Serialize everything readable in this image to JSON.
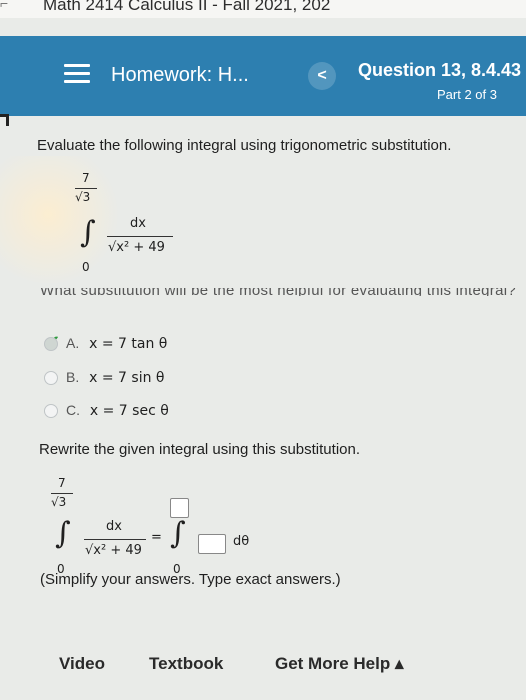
{
  "course": {
    "title": "Math 2414 Calculus II - Fall 2021, 202"
  },
  "header": {
    "homework_title": "Homework: H...",
    "back_glyph": "<",
    "question_title": "Question 13, 8.4.43",
    "part": "Part 2 of 3"
  },
  "question": {
    "prompt": "Evaluate the following integral using trigonometric substitution.",
    "integral": {
      "upper_num": "7",
      "upper_den": "√3",
      "lower": "0",
      "numerator": "dx",
      "denominator": "√x² + 49"
    },
    "cut_text": "What substitution will be the most helpful for evaluating this integral?",
    "choices": [
      {
        "letter": "A.",
        "expr": "x = 7 tan θ",
        "selected": true
      },
      {
        "letter": "B.",
        "expr": "x = 7 sin θ",
        "selected": false
      },
      {
        "letter": "C.",
        "expr": "x = 7 sec θ",
        "selected": false
      }
    ],
    "rewrite_prompt": "Rewrite the given integral using this substitution.",
    "rewrite": {
      "equals": "=",
      "lower_new": "0",
      "dtheta": "dθ"
    },
    "instruction": "(Simplify your answers. Type exact answers.)"
  },
  "footer": {
    "video": "Video",
    "textbook": "Textbook",
    "help": "Get More Help ▴"
  },
  "colors": {
    "header_bg": "#2d7fb0",
    "check": "#2e9a3e"
  }
}
